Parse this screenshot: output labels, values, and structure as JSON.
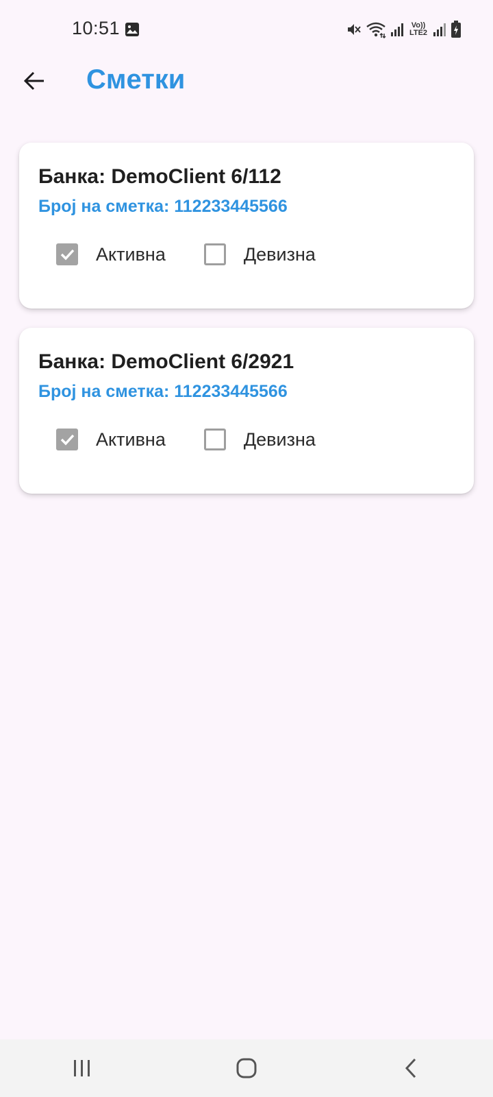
{
  "status_bar": {
    "time": "10:51",
    "volte_line1": "Vo))",
    "volte_line2": "LTE2",
    "icons": [
      "gallery-icon",
      "mute-icon",
      "wifi-icon",
      "signal-icon",
      "volte-icon",
      "signal-icon",
      "battery-charging-icon"
    ]
  },
  "app_bar": {
    "title": "Сметки",
    "back_icon": "arrow-back-icon"
  },
  "accounts": [
    {
      "bank": "Банка: DemoClient 6/112",
      "account_number": "Број на сметка: 112233445566",
      "active_label": "Активна",
      "active_checked": true,
      "foreign_label": "Девизна",
      "foreign_checked": false
    },
    {
      "bank": "Банка: DemoClient 6/2921",
      "account_number": "Број на сметка: 112233445566",
      "active_label": "Активна",
      "active_checked": true,
      "foreign_label": "Девизна",
      "foreign_checked": false
    }
  ],
  "nav_bar": {
    "buttons": [
      "recent-apps-icon",
      "home-icon",
      "back-icon"
    ]
  },
  "colors": {
    "accent": "#2f93e0",
    "background": "#fcf5fc",
    "checkbox_checked": "#a3a3a3"
  }
}
